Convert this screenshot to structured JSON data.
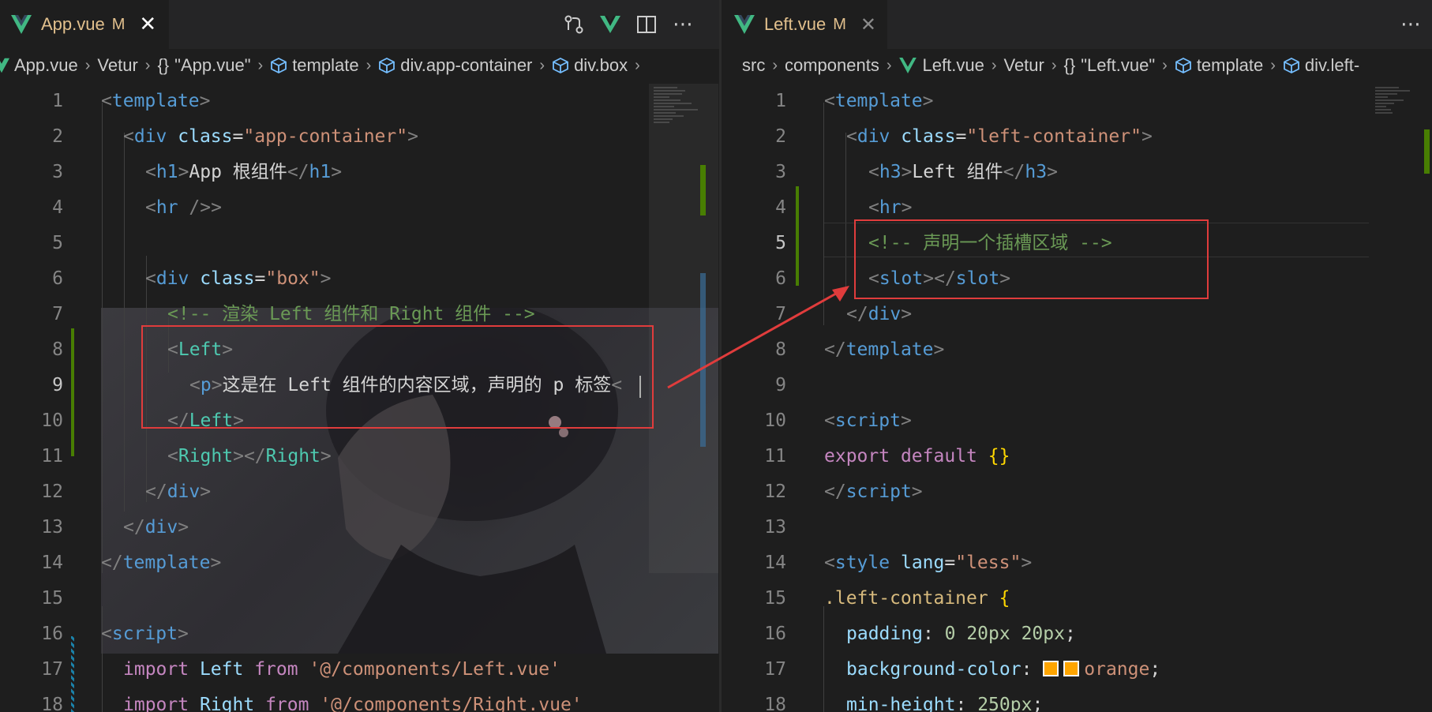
{
  "left_editor": {
    "tab": {
      "title": "App.vue",
      "modified": "M",
      "color": "#e2c08d"
    },
    "actions": [
      "source-control-icon",
      "vue-devtools-icon",
      "split-editor-icon",
      "more-actions-icon"
    ],
    "breadcrumb": [
      "App.vue",
      "Vetur",
      "\"App.vue\"",
      "template",
      "div.app-container",
      "div.box"
    ],
    "lines": [
      {
        "n": "1"
      },
      {
        "n": "2"
      },
      {
        "n": "3"
      },
      {
        "n": "4"
      },
      {
        "n": "5"
      },
      {
        "n": "6"
      },
      {
        "n": "7"
      },
      {
        "n": "8"
      },
      {
        "n": "9"
      },
      {
        "n": "10"
      },
      {
        "n": "11"
      },
      {
        "n": "12"
      },
      {
        "n": "13"
      },
      {
        "n": "14"
      },
      {
        "n": "15"
      },
      {
        "n": "16"
      },
      {
        "n": "17"
      },
      {
        "n": "18"
      }
    ],
    "code": {
      "l1": {
        "tag": "template"
      },
      "l2": {
        "tag": "div",
        "attr": "class",
        "val": "\"app-container\""
      },
      "l3": {
        "tag": "h1",
        "text": "App 根组件",
        "close": "h1"
      },
      "l4": {
        "tag": "hr",
        "self": " />"
      },
      "l6": {
        "tag": "div",
        "attr": "class",
        "val": "\"box\""
      },
      "l7": {
        "comment": "<!-- 渲染 Left 组件和 Right 组件 -->"
      },
      "l8": {
        "tag": "Left"
      },
      "l9": {
        "tag": "p",
        "text": "这是在 Left 组件的内容区域，声明的 p 标签",
        "trail": "<"
      },
      "l10": {
        "tag": "Left"
      },
      "l11": {
        "open": "Right",
        "close": "Right"
      },
      "l12": {
        "tag": "div"
      },
      "l13": {
        "tag": "div"
      },
      "l14": {
        "tag": "template"
      },
      "l16": {
        "tag": "script"
      },
      "l17": {
        "kw1": "import",
        "name": "Left",
        "kw2": "from",
        "path": "'@/components/Left.vue'"
      },
      "l18": {
        "kw1": "import",
        "name": "Right",
        "kw2": "from",
        "path": "'@/components/Right.vue'"
      }
    }
  },
  "right_editor": {
    "tab": {
      "title": "Left.vue",
      "modified": "M",
      "color": "#e2c08d"
    },
    "actions": [
      "more-actions-icon"
    ],
    "breadcrumb": [
      "src",
      "components",
      "Left.vue",
      "Vetur",
      "\"Left.vue\"",
      "template",
      "div.left-"
    ],
    "lines": [
      {
        "n": "1"
      },
      {
        "n": "2"
      },
      {
        "n": "3"
      },
      {
        "n": "4"
      },
      {
        "n": "5"
      },
      {
        "n": "6"
      },
      {
        "n": "7"
      },
      {
        "n": "8"
      },
      {
        "n": "9"
      },
      {
        "n": "10"
      },
      {
        "n": "11"
      },
      {
        "n": "12"
      },
      {
        "n": "13"
      },
      {
        "n": "14"
      },
      {
        "n": "15"
      },
      {
        "n": "16"
      },
      {
        "n": "17"
      },
      {
        "n": "18"
      }
    ],
    "code": {
      "l1": {
        "tag": "template"
      },
      "l2": {
        "tag": "div",
        "attr": "class",
        "val": "\"left-container\""
      },
      "l3": {
        "tag": "h3",
        "text": "Left 组件",
        "close": "h3"
      },
      "l4": {
        "tag": "hr"
      },
      "l5": {
        "comment": "<!-- 声明一个插槽区域 -->"
      },
      "l6": {
        "open": "slot",
        "close": "slot"
      },
      "l7": {
        "tag": "div"
      },
      "l8": {
        "tag": "template"
      },
      "l10": {
        "tag": "script"
      },
      "l11": {
        "kw1": "export",
        "kw2": "default",
        "braces": "{}"
      },
      "l12": {
        "tag": "script"
      },
      "l14": {
        "tag": "style",
        "attr": "lang",
        "val": "\"less\""
      },
      "l15": {
        "selector": ".left-container",
        "brace": "{"
      },
      "l16": {
        "prop": "padding",
        "value": "0 20px 20px"
      },
      "l17": {
        "prop": "background-color",
        "value": "orange"
      },
      "l18": {
        "prop": "min-height",
        "value": "250px"
      }
    },
    "swatch_color": "#ffa500"
  },
  "annotation": {
    "box_color": "#e03c3c"
  }
}
